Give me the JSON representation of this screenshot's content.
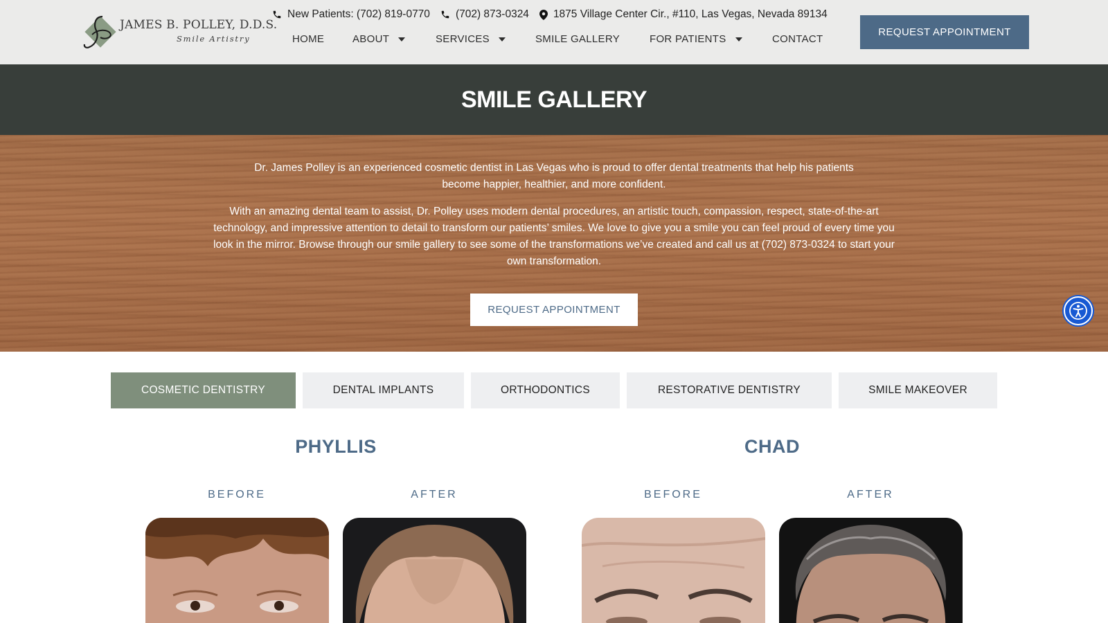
{
  "header": {
    "logo": {
      "name": "JAMES B. POLLEY, D.D.S.",
      "tagline": "Smile Artistry"
    },
    "topbar": {
      "new_patients": "New Patients: (702) 819-0770",
      "phone": "(702) 873-0324",
      "address": "1875 Village Center Cir., #110, Las Vegas, Nevada 89134"
    },
    "nav": [
      {
        "label": "HOME",
        "has_dropdown": false
      },
      {
        "label": "ABOUT",
        "has_dropdown": true
      },
      {
        "label": "SERVICES",
        "has_dropdown": true
      },
      {
        "label": "SMILE GALLERY",
        "has_dropdown": false
      },
      {
        "label": "FOR PATIENTS",
        "has_dropdown": true
      },
      {
        "label": "CONTACT",
        "has_dropdown": false
      }
    ],
    "cta": "REQUEST APPOINTMENT"
  },
  "page_title": "SMILE GALLERY",
  "hero": {
    "paragraph1": "Dr. James Polley is an experienced cosmetic dentist in Las Vegas who is proud to offer dental treatments that help his patients become happier, healthier, and more confident.",
    "paragraph2": "With an amazing dental team to assist, Dr. Polley uses modern dental procedures, an artistic touch, compassion, respect, state-of-the-art technology, and impressive attention to detail to transform our patients’ smiles. We love to give you a smile you can feel proud of every time you look in the mirror. Browse through our smile gallery to see some of the transformations we’ve created and call us at (702) 873-0324 to start your own transformation.",
    "cta": "REQUEST APPOINTMENT"
  },
  "tabs": [
    {
      "label": "COSMETIC DENTISTRY",
      "active": true
    },
    {
      "label": "DENTAL IMPLANTS",
      "active": false
    },
    {
      "label": "ORTHODONTICS",
      "active": false
    },
    {
      "label": "RESTORATIVE DENTISTRY",
      "active": false
    },
    {
      "label": "SMILE MAKEOVER",
      "active": false
    }
  ],
  "gallery": [
    {
      "name": "PHYLLIS",
      "before_label": "BEFORE",
      "after_label": "AFTER"
    },
    {
      "name": "CHAD",
      "before_label": "BEFORE",
      "after_label": "AFTER"
    }
  ],
  "icons": {
    "phone": "phone-icon",
    "location": "location-pin-icon",
    "accessibility": "accessibility-icon",
    "dropdown": "caret-down-icon"
  },
  "colors": {
    "header_bg": "#ebebea",
    "title_band": "#383e3a",
    "accent_blue": "#4d6a87",
    "active_tab": "#7f8f7c",
    "inactive_tab": "#eeeff1",
    "accessibility_blue": "#1759d3"
  }
}
